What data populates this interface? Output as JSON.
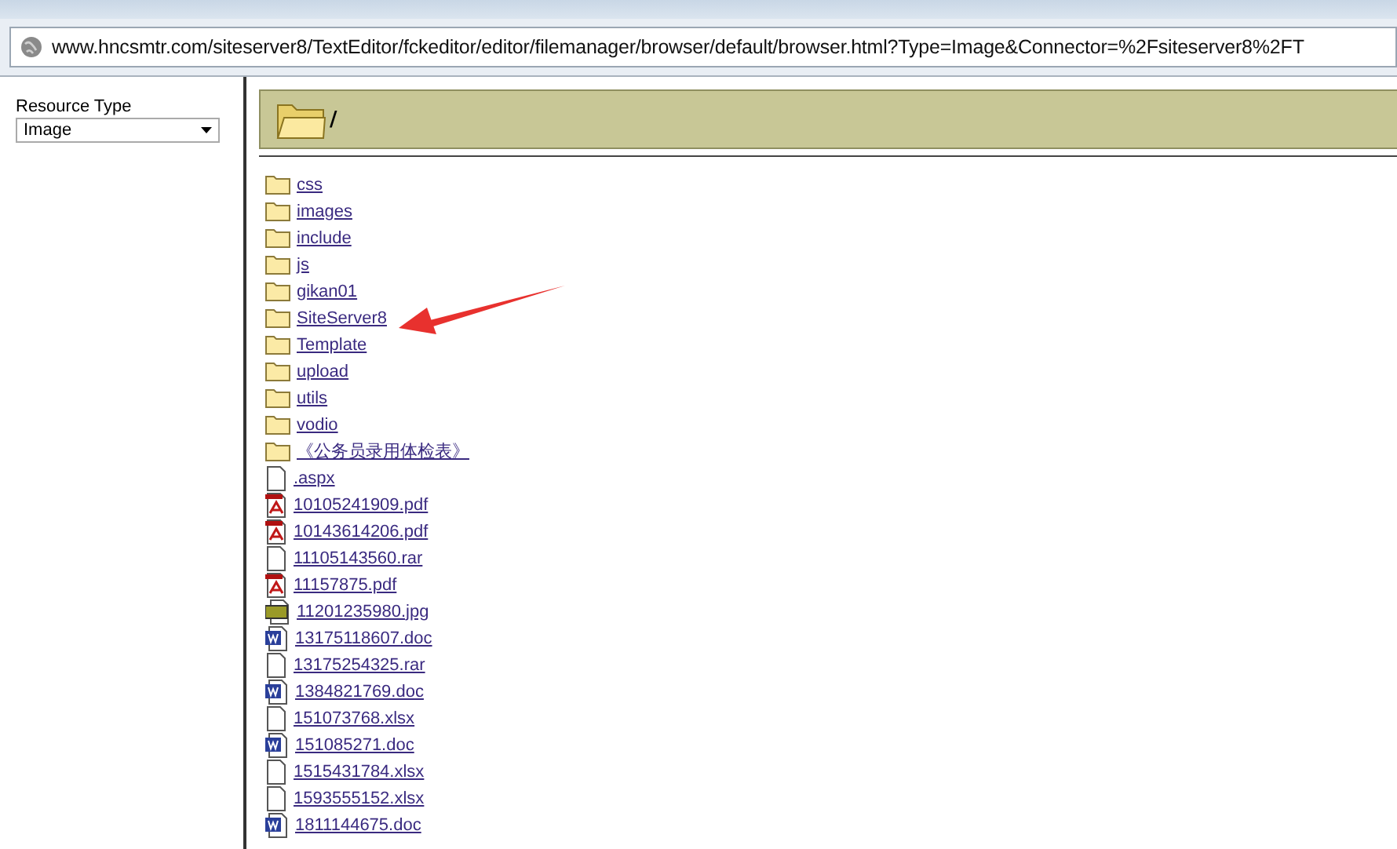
{
  "address_bar": {
    "url": "www.hncsmtr.com/siteserver8/TextEditor/fckeditor/editor/filemanager/browser/default/browser.html?Type=Image&Connector=%2Fsiteserver8%2FT"
  },
  "sidebar": {
    "label": "Resource Type",
    "select_value": "Image"
  },
  "header": {
    "path": "/"
  },
  "files": [
    {
      "name": "css",
      "kind": "folder"
    },
    {
      "name": "images",
      "kind": "folder"
    },
    {
      "name": "include",
      "kind": "folder"
    },
    {
      "name": "js",
      "kind": "folder"
    },
    {
      "name": "gikan01",
      "kind": "folder"
    },
    {
      "name": "SiteServer8",
      "kind": "folder"
    },
    {
      "name": "Template",
      "kind": "folder"
    },
    {
      "name": "upload",
      "kind": "folder"
    },
    {
      "name": "utils",
      "kind": "folder"
    },
    {
      "name": "vodio",
      "kind": "folder"
    },
    {
      "name": "《公务员录用体检表》",
      "kind": "folder"
    },
    {
      "name": ".aspx",
      "kind": "blank"
    },
    {
      "name": "10105241909.pdf",
      "kind": "pdf"
    },
    {
      "name": "10143614206.pdf",
      "kind": "pdf"
    },
    {
      "name": "11105143560.rar",
      "kind": "blank"
    },
    {
      "name": "11157875.pdf",
      "kind": "pdf"
    },
    {
      "name": "11201235980.jpg",
      "kind": "jpg"
    },
    {
      "name": "13175118607.doc",
      "kind": "doc"
    },
    {
      "name": "13175254325.rar",
      "kind": "blank"
    },
    {
      "name": "1384821769.doc",
      "kind": "doc"
    },
    {
      "name": "151073768.xlsx",
      "kind": "blank"
    },
    {
      "name": "151085271.doc",
      "kind": "doc"
    },
    {
      "name": "1515431784.xlsx",
      "kind": "blank"
    },
    {
      "name": "1593555152.xlsx",
      "kind": "blank"
    },
    {
      "name": "1811144675.doc",
      "kind": "doc"
    }
  ]
}
